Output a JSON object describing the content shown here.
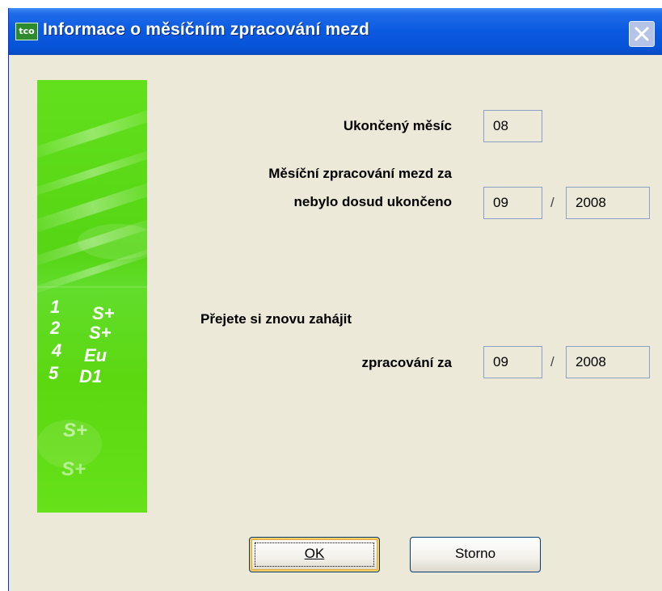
{
  "window": {
    "title": "Informace o měsíčním zpracování mezd",
    "app_icon_text": "tco"
  },
  "side_image": {
    "text_rows": [
      [
        "1",
        "S+"
      ],
      [
        "2",
        "S+"
      ],
      [
        "4",
        "Eu"
      ],
      [
        "5",
        "D1"
      ],
      [
        "",
        "S+"
      ],
      [
        "",
        "S+"
      ]
    ]
  },
  "form": {
    "finished_month_label": "Ukončený měsíc",
    "finished_month_value": "08",
    "not_finished_label_line1": "Měsíční zpracování mezd za",
    "not_finished_label_line2": "nebylo dosud ukončeno",
    "not_finished_month": "09",
    "not_finished_year": "2008",
    "restart_label_line1": "Přejete si znovu zahájit",
    "restart_label_line2": "zpracování za",
    "restart_month": "09",
    "restart_year": "2008",
    "separator": "/"
  },
  "buttons": {
    "ok_label": "OK",
    "cancel_label": "Storno"
  }
}
